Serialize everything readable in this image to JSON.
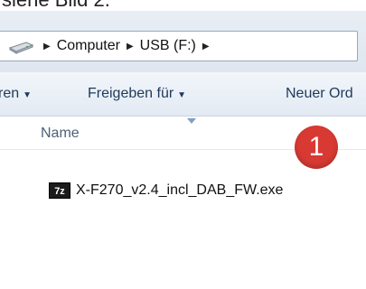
{
  "caption": "siehe Bild 2.",
  "address": {
    "drive_icon": "usb-drive-icon",
    "crumbs": [
      "Computer",
      "USB (F:)"
    ]
  },
  "toolbar": {
    "organize_fragment": "ren",
    "share_label": "Freigeben für",
    "new_folder_fragment": "Neuer Ord"
  },
  "list": {
    "name_header": "Name",
    "files": [
      {
        "icon_text": "7z",
        "name": "X-F270_v2.4_incl_DAB_FW.exe"
      }
    ]
  },
  "callout": {
    "number": "1",
    "color": "#d83a33"
  }
}
